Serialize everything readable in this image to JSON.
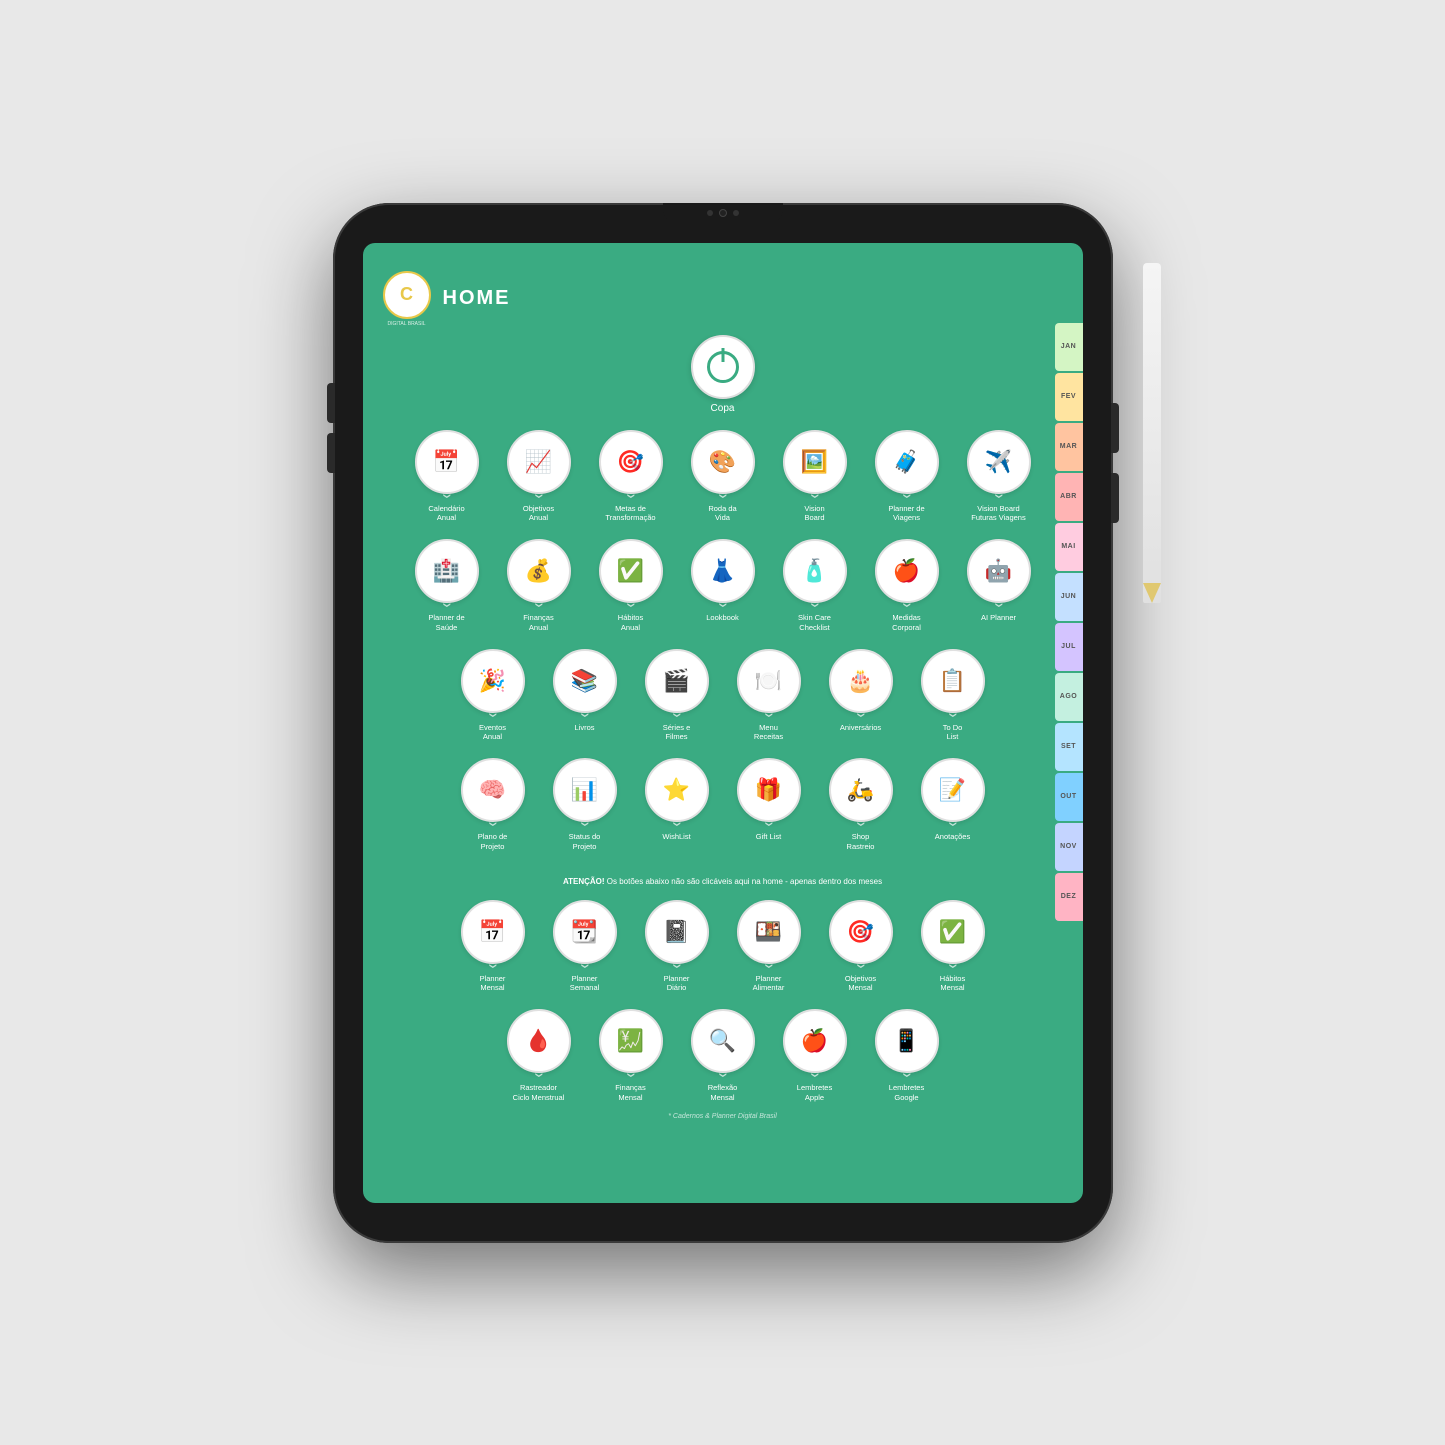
{
  "device": {
    "title": "HOME"
  },
  "header": {
    "title": "HOME",
    "logo_letter": "C",
    "brand_text": "DIGITAL BRASIL"
  },
  "copa": {
    "label": "Copa"
  },
  "side_tabs": [
    {
      "id": "jan",
      "label": "JAN",
      "color": "#d4f5c4"
    },
    {
      "id": "fev",
      "label": "FEV",
      "color": "#ffe4a0"
    },
    {
      "id": "mar",
      "label": "MAR",
      "color": "#ffc4a0"
    },
    {
      "id": "abr",
      "label": "ABR",
      "color": "#ffb4b4"
    },
    {
      "id": "mai",
      "label": "MAI",
      "color": "#ffcce0"
    },
    {
      "id": "jun",
      "label": "JUN",
      "color": "#c4e0ff"
    },
    {
      "id": "jul",
      "label": "JUL",
      "color": "#d4c4ff"
    },
    {
      "id": "ago",
      "label": "AGO",
      "color": "#c4f0e0"
    },
    {
      "id": "set",
      "label": "SET",
      "color": "#b4e4ff"
    },
    {
      "id": "out",
      "label": "OUT",
      "color": "#80d0ff"
    },
    {
      "id": "nov",
      "label": "NOV",
      "color": "#c4d4ff"
    },
    {
      "id": "dez",
      "label": "DEZ",
      "color": "#ffb4c4"
    }
  ],
  "row1": [
    {
      "emoji": "📅",
      "label": "Calendário\nAnual"
    },
    {
      "emoji": "📈",
      "label": "Objetivos\nAnual"
    },
    {
      "emoji": "🎯",
      "label": "Metas de\nTransformação"
    },
    {
      "emoji": "🎨",
      "label": "Roda da\nVida"
    },
    {
      "emoji": "🖼️",
      "label": "Vision\nBoard"
    },
    {
      "emoji": "🧳",
      "label": "Planner de\nViagens"
    },
    {
      "emoji": "✈️",
      "label": "Vision Board\nFuturas Viagens"
    }
  ],
  "row2": [
    {
      "emoji": "🏥",
      "label": "Planner de\nSaúde"
    },
    {
      "emoji": "💰",
      "label": "Finanças\nAnual"
    },
    {
      "emoji": "✅",
      "label": "Hábitos\nAnual"
    },
    {
      "emoji": "👗",
      "label": "Lookbook"
    },
    {
      "emoji": "🧴",
      "label": "Skin Care\nChecklist"
    },
    {
      "emoji": "🍎",
      "label": "Medidas\nCorporal"
    },
    {
      "emoji": "🤖",
      "label": "AI Planner"
    }
  ],
  "row3": [
    {
      "emoji": "🎉",
      "label": "Eventos\nAnual"
    },
    {
      "emoji": "📚",
      "label": "Livros"
    },
    {
      "emoji": "🎬",
      "label": "Séries e\nFilmes"
    },
    {
      "emoji": "🍽️",
      "label": "Menu\nReceitas"
    },
    {
      "emoji": "🎂",
      "label": "Aniversários"
    },
    {
      "emoji": "📋",
      "label": "To Do\nList"
    }
  ],
  "row4": [
    {
      "emoji": "🧠",
      "label": "Plano de\nProjeto"
    },
    {
      "emoji": "📊",
      "label": "Status do\nProjeto"
    },
    {
      "emoji": "⭐",
      "label": "WishList"
    },
    {
      "emoji": "🎁",
      "label": "Gift List"
    },
    {
      "emoji": "🛵",
      "label": "Shop\nRastreio"
    },
    {
      "emoji": "📝",
      "label": "Anotações"
    }
  ],
  "attention": {
    "text_bold": "ATENÇÃO!",
    "text_rest": " Os botões abaixo não são clicáveis aqui na home - apenas dentro dos meses"
  },
  "row5": [
    {
      "emoji": "📅",
      "label": "Planner\nMensal"
    },
    {
      "emoji": "📆",
      "label": "Planner\nSemanal"
    },
    {
      "emoji": "📓",
      "label": "Planner\nDiário"
    },
    {
      "emoji": "🍱",
      "label": "Planner\nAlimentar"
    },
    {
      "emoji": "🎯",
      "label": "Objetivos\nMensal"
    },
    {
      "emoji": "✅",
      "label": "Hábitos\nMensal"
    }
  ],
  "row6": [
    {
      "emoji": "🩸",
      "label": "Rastreador\nCiclo Menstrual"
    },
    {
      "emoji": "💹",
      "label": "Finanças\nMensal"
    },
    {
      "emoji": "🔍",
      "label": "Reflexão\nMensal"
    },
    {
      "emoji": "🍎",
      "label": "Lembretes\nApple"
    },
    {
      "emoji": "📱",
      "label": "Lembretes\nGoogle"
    }
  ],
  "footer": {
    "text": "* Cadernos & Planner Digital Brasil"
  }
}
